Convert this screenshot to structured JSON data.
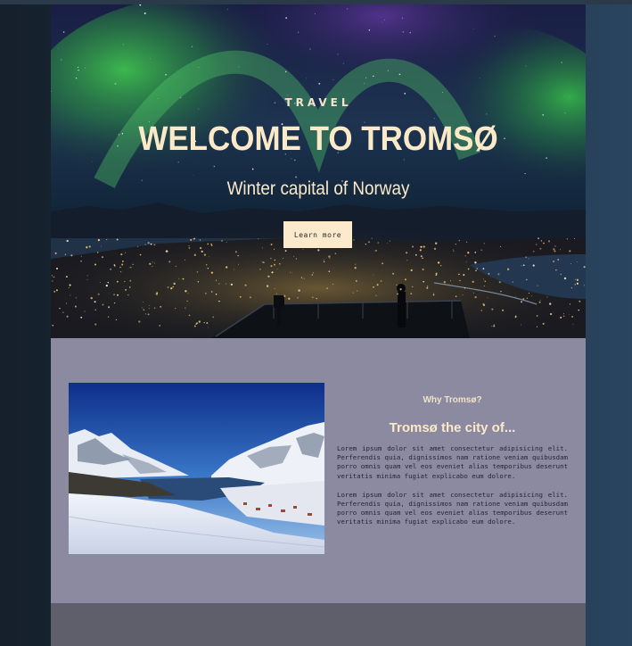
{
  "hero": {
    "eyebrow": "TRAVEL",
    "title": "WELCOME TO TROMSØ",
    "subtitle": "Winter capital of Norway",
    "button_label": "Learn more"
  },
  "about": {
    "kicker": "Why Tromsø?",
    "heading": "Tromsø the city of...",
    "paragraphs": [
      "Lorem ipsum dolor sit amet consectetur adipisicing elit. Perferendis quia, dignissimos nam ratione veniam quibusdam porro omnis quam vel eos eveniet alias temporibus deserunt veritatis minima fugiat explicabo eum dolore.",
      "Lorem ipsum dolor sit amet consectetur adipisicing elit. Perferendis quia, dignissimos nam ratione veniam quibusdam porro omnis quam vel eos eveniet alias temporibus deserunt veritatis minima fugiat explicabo eum dolore."
    ]
  },
  "colors": {
    "cream": "#fbe9c8",
    "about_bg": "#8b8aa0",
    "footer_band": "#5f5f6c"
  },
  "images": {
    "hero": "aurora-over-city-photo",
    "about": "snowy-fjord-photo"
  }
}
